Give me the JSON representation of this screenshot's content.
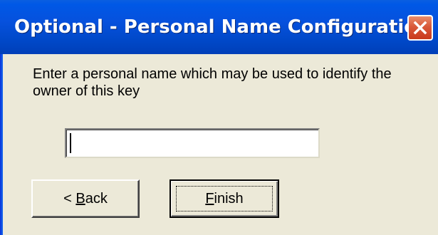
{
  "window": {
    "title": "Optional - Personal Name Configuration"
  },
  "prompt": {
    "text": "Enter a personal name which may be used to identify the owner of this key"
  },
  "name_field": {
    "value": "",
    "placeholder": ""
  },
  "buttons": {
    "back_prefix": "< ",
    "back_mnemonic": "B",
    "back_rest": "ack",
    "finish_mnemonic": "F",
    "finish_rest": "inish"
  },
  "icons": {
    "close": "close-icon"
  },
  "colors": {
    "titlebar": "#0054e3",
    "dialog_background": "#ece9d8",
    "close_button": "#d9593a"
  }
}
